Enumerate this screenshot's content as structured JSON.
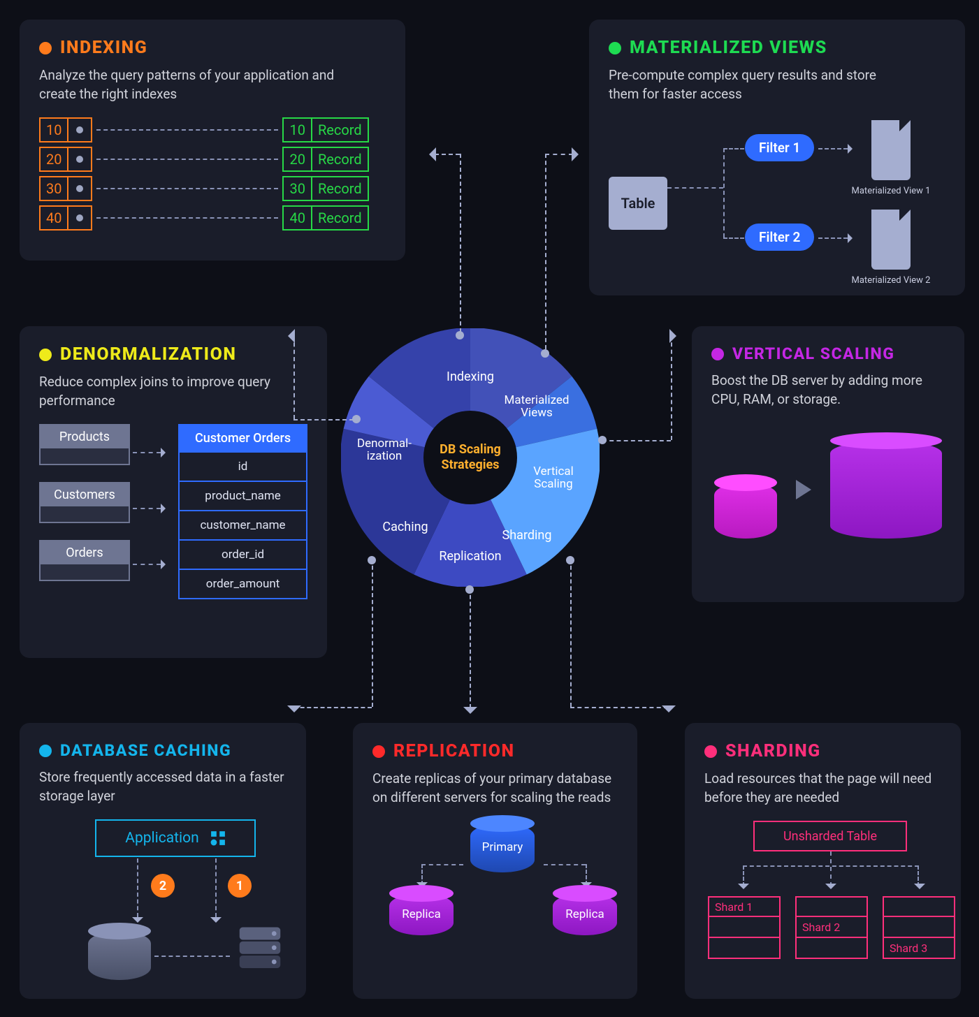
{
  "center": {
    "label": "DB Scaling Strategies"
  },
  "wheel": {
    "segments": [
      {
        "label": "Indexing"
      },
      {
        "label": "Materialized Views"
      },
      {
        "label": "Vertical Scaling"
      },
      {
        "label": "Sharding"
      },
      {
        "label": "Replication"
      },
      {
        "label": "Caching"
      },
      {
        "label": "Denormal-\nization"
      }
    ]
  },
  "indexing": {
    "title": "INDEXING",
    "desc": "Analyze the query patterns of your application and create the right indexes",
    "keys": [
      "10",
      "20",
      "30",
      "40"
    ],
    "record_label": "Record"
  },
  "matv": {
    "title": "MATERIALIZED VIEWS",
    "desc": "Pre-compute complex query results and store them for faster access",
    "table": "Table",
    "filter1": "Filter 1",
    "filter2": "Filter 2",
    "mv1": "Materialized View 1",
    "mv2": "Materialized View 2"
  },
  "denorm": {
    "title": "DENORMALIZATION",
    "desc": "Reduce complex joins to improve query performance",
    "sources": [
      "Products",
      "Customers",
      "Orders"
    ],
    "target_head": "Customer Orders",
    "target_rows": [
      "id",
      "product_name",
      "customer_name",
      "order_id",
      "order_amount"
    ]
  },
  "vscale": {
    "title": "VERTICAL SCALING",
    "desc": "Boost the DB server by adding more CPU, RAM, or storage."
  },
  "cache": {
    "title": "DATABASE CACHING",
    "desc": "Store frequently accessed data in a faster storage layer",
    "app_label": "Application",
    "step1": "1",
    "step2": "2"
  },
  "repl": {
    "title": "REPLICATION",
    "desc": "Create replicas of your primary database on different servers for scaling the reads",
    "primary": "Primary",
    "replica": "Replica"
  },
  "shard": {
    "title": "SHARDING",
    "desc": "Load resources that the page will need before they are needed",
    "unsharded": "Unsharded Table",
    "shard1": "Shard 1",
    "shard2": "Shard 2",
    "shard3": "Shard 3"
  }
}
